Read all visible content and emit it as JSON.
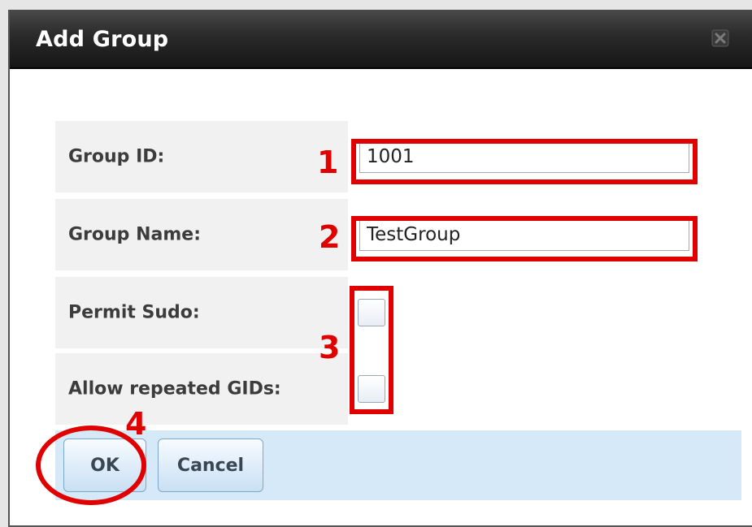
{
  "dialog": {
    "title": "Add Group",
    "close_icon": "close-icon"
  },
  "form": {
    "group_id": {
      "label": "Group ID:",
      "value": "1001"
    },
    "group_name": {
      "label": "Group Name:",
      "value": "TestGroup"
    },
    "permit_sudo": {
      "label": "Permit Sudo:",
      "checked": false
    },
    "allow_repeated_gids": {
      "label": "Allow repeated GIDs:",
      "checked": false
    }
  },
  "buttons": {
    "ok": "OK",
    "cancel": "Cancel"
  },
  "annotations": {
    "step1": "1",
    "step2": "2",
    "step3": "3",
    "step4": "4",
    "color": "#e00000"
  },
  "colors": {
    "titlebar": "#2a2a2a",
    "label_cell": "#f1f1f1",
    "button_bar": "#d6e9f8"
  }
}
